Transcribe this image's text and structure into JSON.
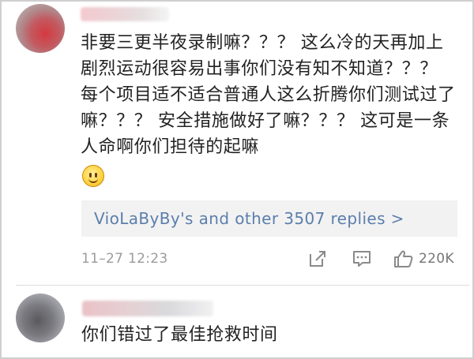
{
  "comments": [
    {
      "text": "非要三更半夜录制嘛？？？ 这么冷的天再加上剧烈运动很容易出事你们没有知不知道？？？ 每个项目适不适合普通人这么折腾你们测试过了嘛？？？ 安全措施做好了嘛？？？ 这可是一条人命啊你们担待的起嘛",
      "emoji": "smile-emoji",
      "replies_label": "VioLaByBy's and other 3507 replies >",
      "time": "11–27 12:23",
      "like_count": "220K"
    },
    {
      "text": "你们错过了最佳抢救时间"
    }
  ],
  "colors": {
    "reply_link": "#5b7eac",
    "meta_gray": "#9b9b9b",
    "replies_bg": "#f2f2f2"
  },
  "icons": [
    "share-icon",
    "comment-icon",
    "like-icon"
  ]
}
